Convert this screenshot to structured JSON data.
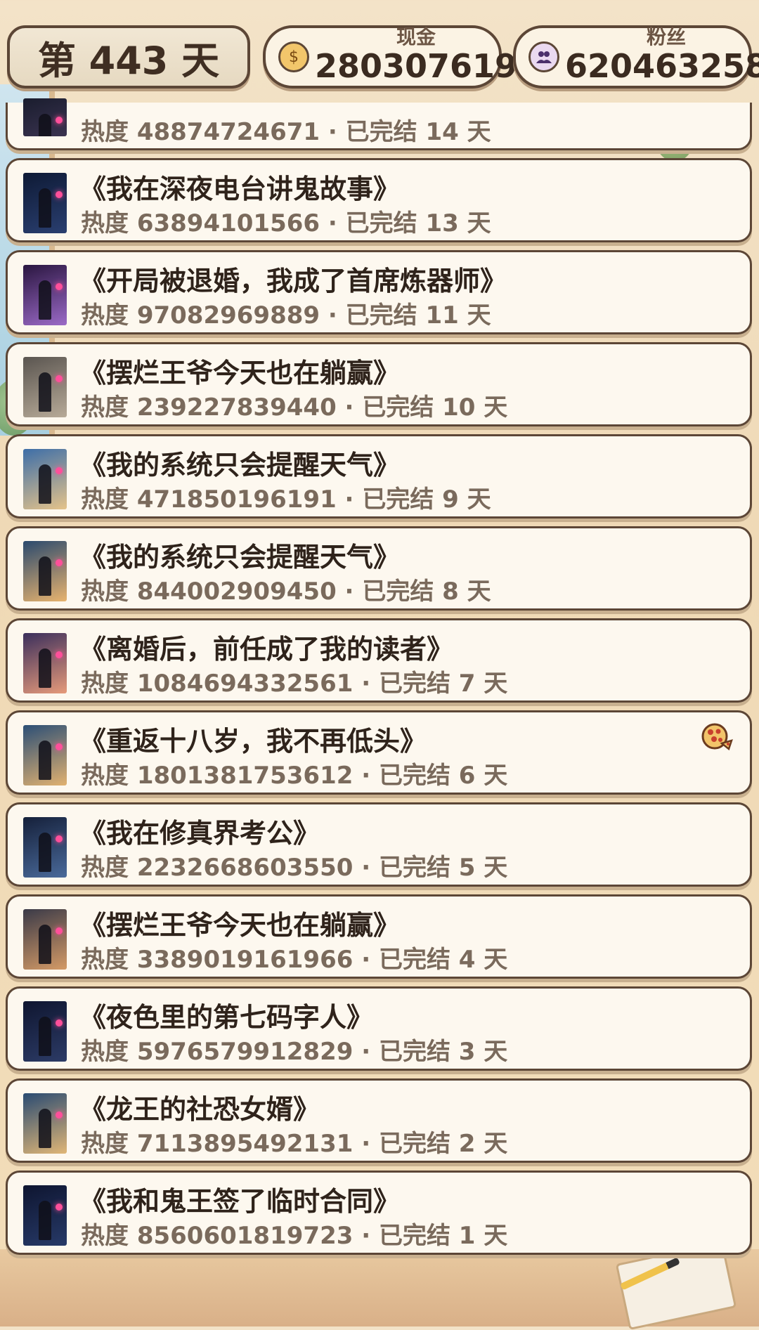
{
  "hud": {
    "day": "第 443 天",
    "cash_label": "现金",
    "cash_value": "280307619",
    "fans_label": "粉丝",
    "fans_value": "620463258",
    "cash_icon": "money-bag-icon",
    "fans_icon": "people-icon"
  },
  "books": [
    {
      "title": "",
      "meta": "热度 48874724671 · 已完结 14 天",
      "cover": [
        "#1a1d2e",
        "#3a3350"
      ],
      "partial": true
    },
    {
      "title": "《我在深夜电台讲鬼故事》",
      "meta": "热度 63894101566 · 已完结 13 天",
      "cover": [
        "#0e1a35",
        "#2a3f70"
      ]
    },
    {
      "title": "《开局被退婚，我成了首席炼器师》",
      "meta": "热度 97082969889 · 已完结 11 天",
      "cover": [
        "#2a1640",
        "#9b6ac7"
      ]
    },
    {
      "title": "《摆烂王爷今天也在躺赢》",
      "meta": "热度 239227839440 · 已完结 10 天",
      "cover": [
        "#5a5550",
        "#b7aa98"
      ]
    },
    {
      "title": "《我的系统只会提醒天气》",
      "meta": "热度 471850196191 · 已完结 9 天",
      "cover": [
        "#3d6ea8",
        "#e5c38a"
      ]
    },
    {
      "title": "《我的系统只会提醒天气》",
      "meta": "热度 844002909450 · 已完结 8 天",
      "cover": [
        "#2b4a6e",
        "#e8b36e"
      ]
    },
    {
      "title": "《离婚后，前任成了我的读者》",
      "meta": "热度 1084694332561 · 已完结 7 天",
      "cover": [
        "#3b2f5c",
        "#e69a7a"
      ]
    },
    {
      "title": "《重返十八岁，我不再低头》",
      "meta": "热度 1801381753612 · 已完结 6 天",
      "cover": [
        "#2c4f76",
        "#e1b170"
      ],
      "badge": "pizza-icon"
    },
    {
      "title": "《我在修真界考公》",
      "meta": "热度 2232668603550 · 已完结 5 天",
      "cover": [
        "#15203a",
        "#4a6a9a"
      ]
    },
    {
      "title": "《摆烂王爷今天也在躺赢》",
      "meta": "热度 3389019161966 · 已完结 4 天",
      "cover": [
        "#3a3a48",
        "#d49a66"
      ]
    },
    {
      "title": "《夜色里的第七码字人》",
      "meta": "热度 5976579912829 · 已完结 3 天",
      "cover": [
        "#0f1630",
        "#2c3b66"
      ]
    },
    {
      "title": "《龙王的社恐女婿》",
      "meta": "热度 7113895492131 · 已完结 2 天",
      "cover": [
        "#2a4b72",
        "#e0b676"
      ]
    },
    {
      "title": "《我和鬼王签了临时合同》",
      "meta": "热度 8560601819723 · 已完结 1 天",
      "cover": [
        "#0e1530",
        "#273a68"
      ]
    }
  ]
}
